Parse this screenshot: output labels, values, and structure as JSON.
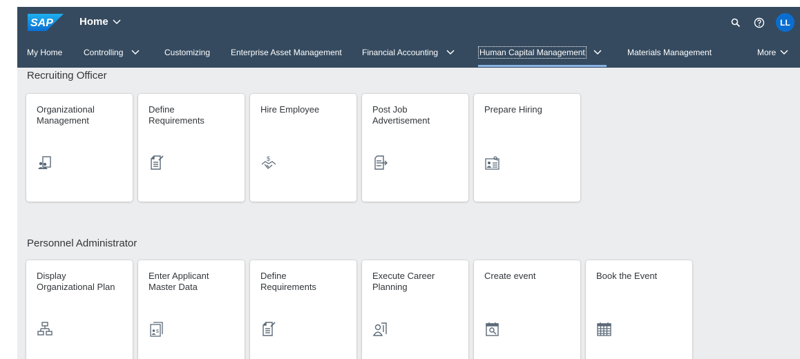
{
  "header": {
    "logo_text": "SAP",
    "home_title": "Home",
    "avatar_initials": "LL",
    "colors": {
      "shell": "#354a5f",
      "accent": "#0a6ed1",
      "background": "#ecedee"
    }
  },
  "nav": {
    "items": [
      {
        "label": "My Home",
        "has_menu": false
      },
      {
        "label": "Controlling",
        "has_menu": true
      },
      {
        "label": "Customizing",
        "has_menu": false
      },
      {
        "label": "Enterprise Asset Management",
        "has_menu": false
      },
      {
        "label": "Financial Accounting",
        "has_menu": true
      },
      {
        "label": "Human Capital Management",
        "has_menu": true,
        "active": true
      },
      {
        "label": "Materials Management",
        "has_menu": false
      },
      {
        "label": "More",
        "has_menu": true
      }
    ]
  },
  "sections": [
    {
      "title": "Recruiting Officer",
      "tiles": [
        {
          "title": "Organizational\nManagement",
          "icon": "org-people-icon"
        },
        {
          "title": "Define\nRequirements",
          "icon": "document-edit-icon"
        },
        {
          "title": "Hire Employee",
          "icon": "hire-handshake-icon"
        },
        {
          "title": "Post Job\nAdvertisement",
          "icon": "document-post-icon"
        },
        {
          "title": "Prepare Hiring",
          "icon": "person-card-search-icon"
        }
      ]
    },
    {
      "title": "Personnel Administrator",
      "tiles": [
        {
          "title": "Display\nOrganizational Plan",
          "icon": "org-chart-icon"
        },
        {
          "title": "Enter Applicant\nMaster Data",
          "icon": "applicant-data-icon"
        },
        {
          "title": "Define\nRequirements",
          "icon": "document-edit-icon"
        },
        {
          "title": "Execute Career\nPlanning",
          "icon": "career-planning-icon"
        },
        {
          "title": "Create event",
          "icon": "calendar-search-icon"
        },
        {
          "title": "Book the Event",
          "icon": "calendar-grid-icon"
        }
      ]
    }
  ]
}
